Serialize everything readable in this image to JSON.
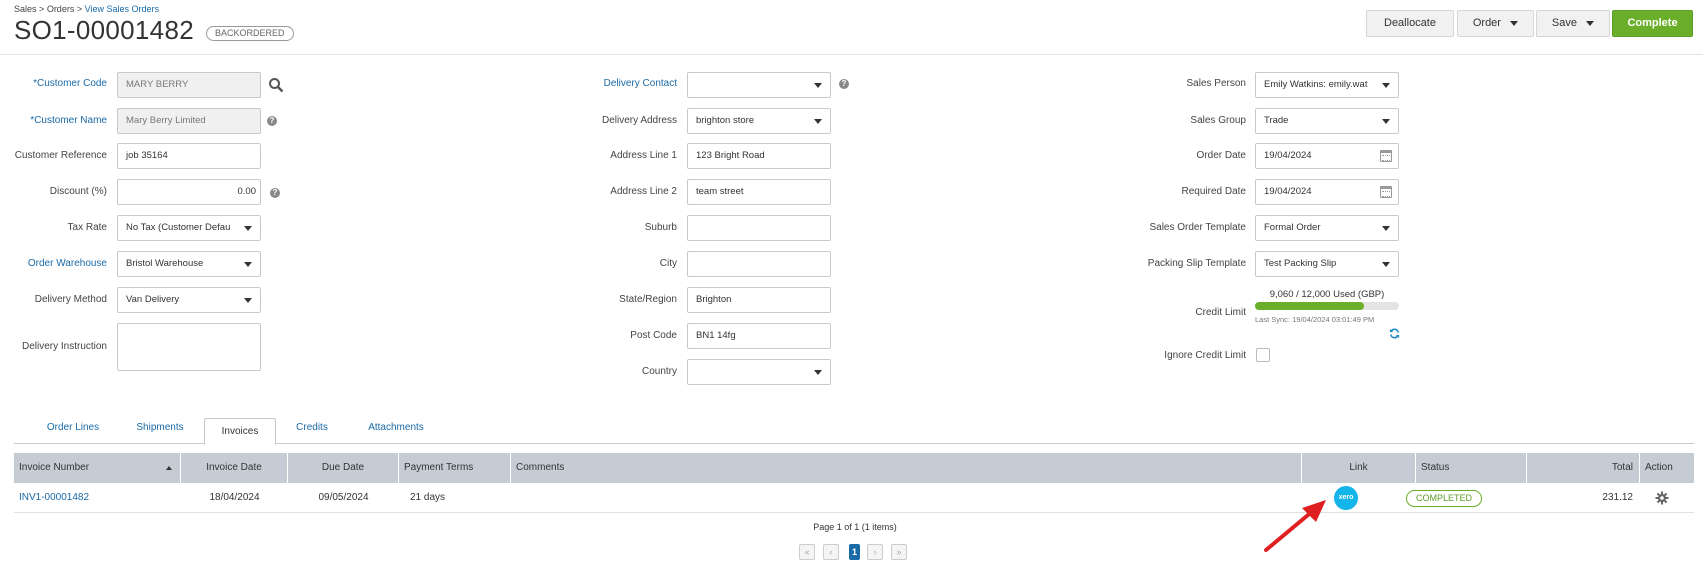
{
  "breadcrumb": {
    "part1": "Sales",
    "sep": ">",
    "part2": "Orders",
    "current": "View Sales Orders"
  },
  "order": {
    "number": "SO1-00001482",
    "status_badge": "BACKORDERED"
  },
  "toolbar": {
    "deallocate": "Deallocate",
    "order": "Order",
    "save": "Save",
    "complete": "Complete"
  },
  "left": {
    "customer_code": {
      "label": "Customer Code",
      "value": "MARY BERRY"
    },
    "customer_name": {
      "label": "Customer Name",
      "value": "Mary Berry Limited"
    },
    "customer_reference": {
      "label": "Customer Reference",
      "value": "job 35164"
    },
    "discount": {
      "label": "Discount (%)",
      "value": "0.00"
    },
    "tax_rate": {
      "label": "Tax Rate",
      "value": "No Tax (Customer Defau"
    },
    "order_warehouse": {
      "label": "Order Warehouse",
      "value": "Bristol Warehouse"
    },
    "delivery_method": {
      "label": "Delivery Method",
      "value": "Van Delivery"
    },
    "delivery_instruction": {
      "label": "Delivery Instruction",
      "value": ""
    }
  },
  "middle": {
    "delivery_contact": {
      "label": "Delivery Contact",
      "value": ""
    },
    "delivery_address": {
      "label": "Delivery Address",
      "value": "brighton store"
    },
    "address_line1": {
      "label": "Address Line 1",
      "value": "123 Bright Road"
    },
    "address_line2": {
      "label": "Address Line 2",
      "value": "team street"
    },
    "suburb": {
      "label": "Suburb",
      "value": ""
    },
    "city": {
      "label": "City",
      "value": ""
    },
    "state_region": {
      "label": "State/Region",
      "value": "Brighton"
    },
    "post_code": {
      "label": "Post Code",
      "value": "BN1 14fg"
    },
    "country": {
      "label": "Country",
      "value": ""
    }
  },
  "right": {
    "sales_person": {
      "label": "Sales Person",
      "value": "Emily Watkins: emily.wat"
    },
    "sales_group": {
      "label": "Sales Group",
      "value": "Trade"
    },
    "order_date": {
      "label": "Order Date",
      "value": "19/04/2024"
    },
    "required_date": {
      "label": "Required Date",
      "value": "19/04/2024"
    },
    "sales_order_template": {
      "label": "Sales Order Template",
      "value": "Formal Order"
    },
    "packing_slip_template": {
      "label": "Packing Slip Template",
      "value": "Test Packing Slip"
    },
    "credit_limit": {
      "label": "Credit Limit",
      "usage_text": "9,060 / 12,000 Used (GBP)",
      "used_fraction": 0.755,
      "last_sync": "Last Sync: 19/04/2024 03:01:49 PM"
    },
    "ignore_credit_limit": {
      "label": "Ignore Credit Limit",
      "checked": false
    }
  },
  "tabs": [
    "Order Lines",
    "Shipments",
    "Invoices",
    "Credits",
    "Attachments"
  ],
  "active_tab": "Invoices",
  "table": {
    "columns": [
      "Invoice Number",
      "Invoice Date",
      "Due Date",
      "Payment Terms",
      "Comments",
      "Link",
      "Status",
      "Total",
      "Action"
    ],
    "rows": [
      {
        "invoice_number": "INV1-00001482",
        "invoice_date": "18/04/2024",
        "due_date": "09/05/2024",
        "payment_terms": "21 days",
        "comments": "",
        "link": "xero",
        "status": "COMPLETED",
        "total": "231.12"
      }
    ]
  },
  "pagination": {
    "summary": "Page 1 of 1 (1 items)",
    "current": "1"
  },
  "colors": {
    "accent": "#1a6aa8",
    "complete": "#6aae2a",
    "xero": "#13b5ea",
    "arrow": "#e02020"
  }
}
